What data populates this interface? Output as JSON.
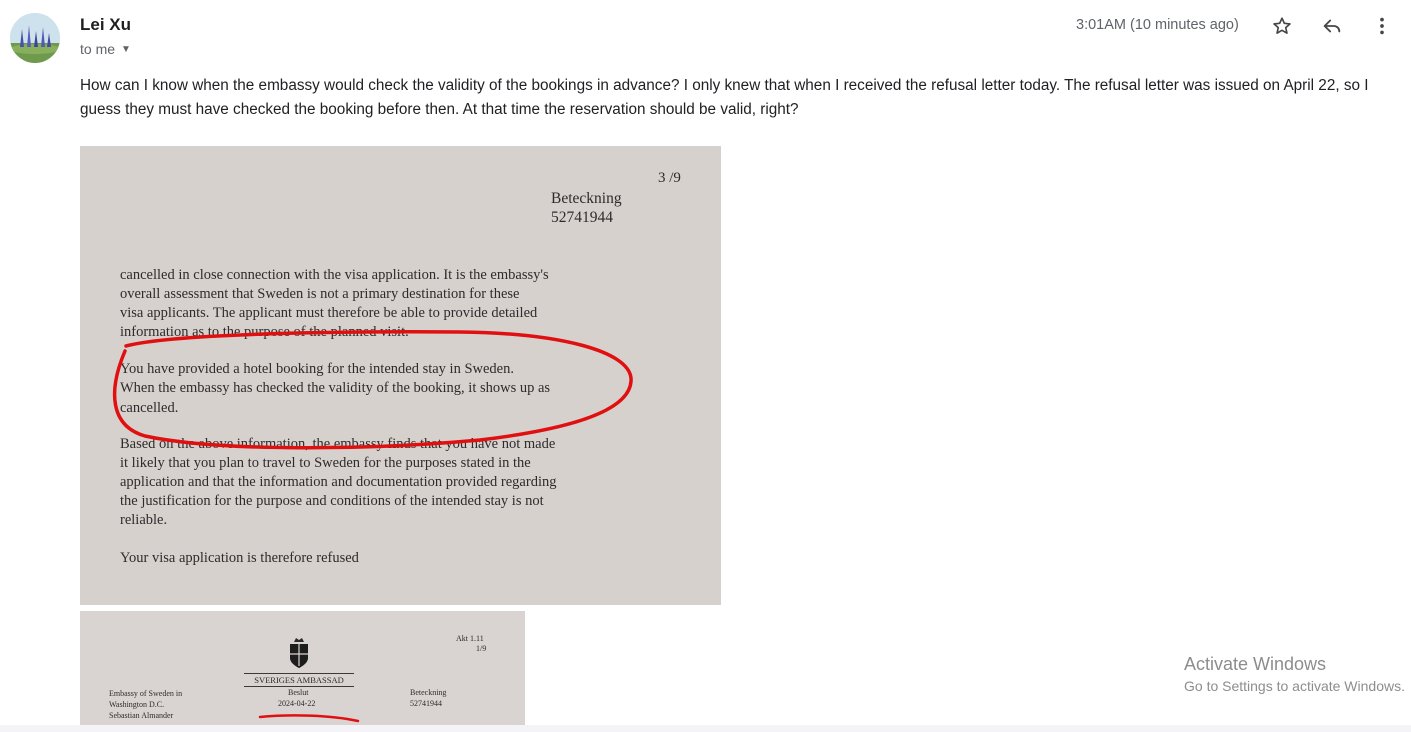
{
  "sender": {
    "name": "Lei Xu",
    "to": "to me",
    "timestamp": "3:01AM (10 minutes ago)"
  },
  "message": {
    "body": "How can I know when the embassy would check the validity of the bookings in advance? I only knew that when I received the refusal letter today. The refusal letter was issued on April 22, so I guess they must have checked the booking before then. At that time the reservation should be valid, right?"
  },
  "attachment1": {
    "page": "3 /9",
    "ref_label": "Beteckning",
    "ref_number": "52741944",
    "para1": [
      "cancelled in close connection with the visa application. It is the embassy's",
      "overall assessment that Sweden is not a primary destination for these",
      "visa applicants. The applicant must therefore be able to provide detailed",
      "information as to the purpose of the planned visit."
    ],
    "para2": [
      "You have provided a hotel booking for the intended stay in Sweden.",
      "When the embassy has checked the validity of the booking, it shows up as",
      "cancelled."
    ],
    "para3": [
      "Based on the above information, the embassy finds that you have not made",
      "it likely that you plan to travel to Sweden for the purposes stated in the",
      "application and that the information and documentation provided regarding",
      "the justification for the purpose and conditions of the intended stay is not",
      "reliable."
    ],
    "conclusion": "Your visa application is therefore refused"
  },
  "attachment2": {
    "akt": "Akt 1.11",
    "page": "1/9",
    "embassy_name": "SVERIGES AMBASSAD",
    "from_line1": "Embassy of Sweden in",
    "from_line2": "Washington D.C.",
    "from_line3": "Sebastian Almander",
    "decision_label": "Beslut",
    "decision_date": "2024-04-22",
    "ref_label": "Beteckning",
    "ref_number": "52741944"
  },
  "watermark": {
    "title": "Activate Windows",
    "subtitle": "Go to Settings to activate Windows."
  }
}
